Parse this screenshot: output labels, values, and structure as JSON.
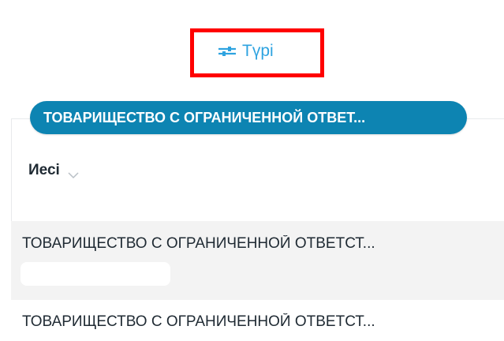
{
  "filter": {
    "label": "Түрі",
    "icon": "sliders-icon",
    "color": "#2ea3e0"
  },
  "highlight": {
    "color": "#ff0000"
  },
  "chip": {
    "label": "ТОВАРИЩЕСТВО С ОГРАНИЧЕННОЙ ОТВЕТ...",
    "color": "#0d84b2"
  },
  "column": {
    "label": "Иесі",
    "icon": "chevron-down-icon"
  },
  "rows": [
    {
      "text": "ТОВАРИЩЕСТВО С ОГРАНИЧЕННОЙ ОТВЕТСТ..."
    },
    {
      "text": "ТОВАРИЩЕСТВО С ОГРАНИЧЕННОЙ ОТВЕТСТ..."
    }
  ]
}
